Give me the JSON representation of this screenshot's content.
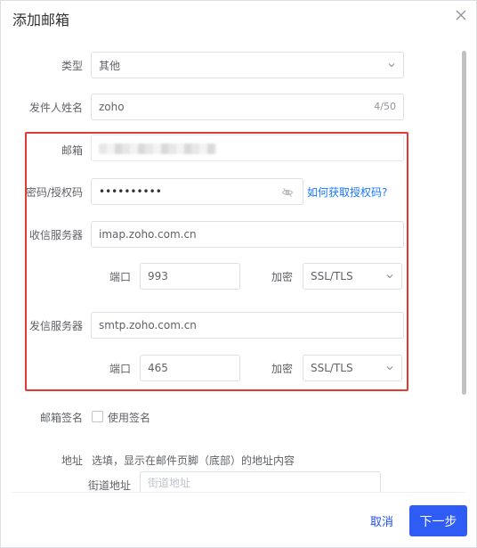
{
  "dialog": {
    "title": "添加邮箱"
  },
  "form": {
    "type": {
      "label": "类型",
      "value": "其他"
    },
    "sender_name": {
      "label": "发件人姓名",
      "value": "zoho",
      "counter": "4/50"
    },
    "email": {
      "label": "邮箱"
    },
    "password": {
      "label": "密码/授权码",
      "value": "••••••••••",
      "help_link": "如何获取授权码?"
    },
    "imap": {
      "label": "收信服务器",
      "value": "imap.zoho.com.cn",
      "port_label": "端口",
      "port_value": "993",
      "encrypt_label": "加密",
      "encrypt_value": "SSL/TLS"
    },
    "smtp": {
      "label": "发信服务器",
      "value": "smtp.zoho.com.cn",
      "port_label": "端口",
      "port_value": "465",
      "encrypt_label": "加密",
      "encrypt_value": "SSL/TLS"
    },
    "signature": {
      "label": "邮箱签名",
      "checkbox_label": "使用签名"
    },
    "address": {
      "label": "地址",
      "hint": "选填，显示在邮件页脚（底部）的地址内容",
      "street_label": "街道地址",
      "street_placeholder": "街道地址"
    }
  },
  "footer": {
    "cancel_label": "取消",
    "next_label": "下一步"
  },
  "colors": {
    "primary": "#2f5cf5",
    "highlight_box": "#e53935",
    "link": "#1677ff"
  }
}
